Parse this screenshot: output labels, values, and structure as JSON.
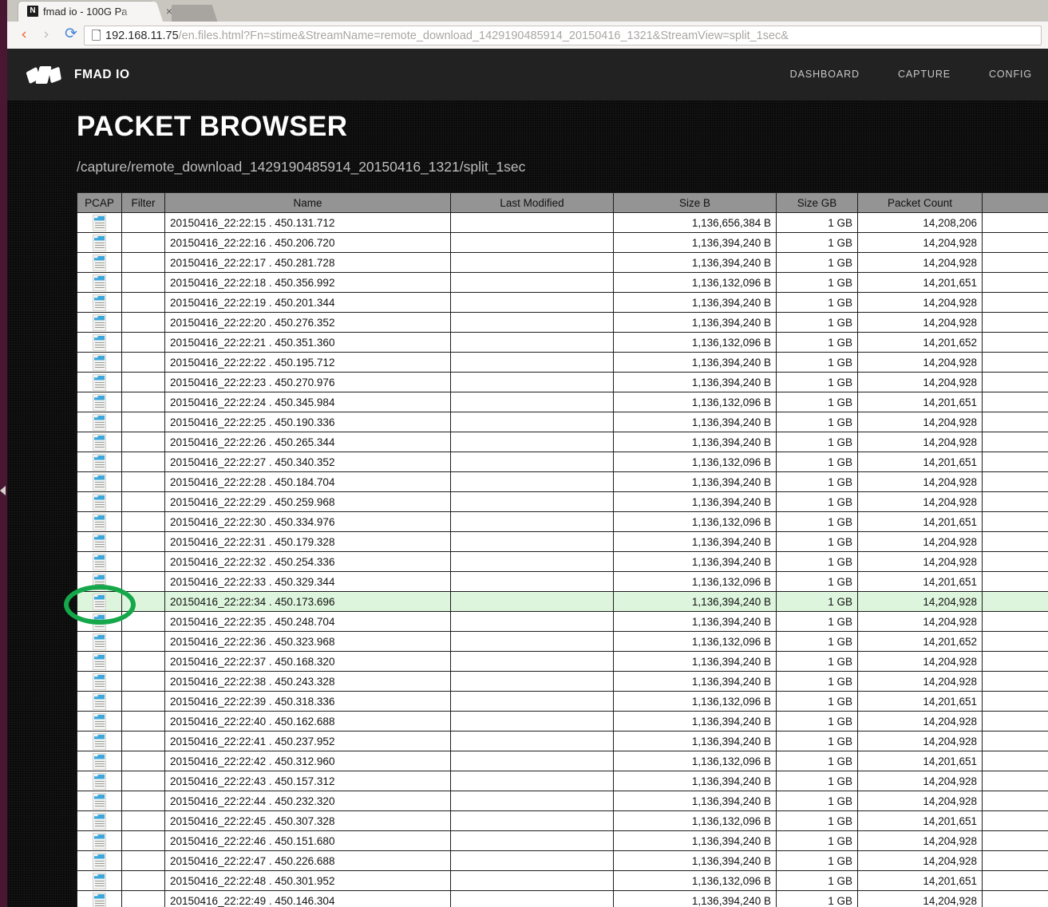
{
  "browser": {
    "tab": {
      "title": "fmad io - 100G Pa",
      "favicon_letter": "N",
      "close_label": "×"
    },
    "back_label": "‹",
    "forward_label": "›",
    "reload_label": "⟳",
    "url_host": "192.168.11.75",
    "url_path": "/en.files.html?Fn=stime&StreamName=remote_download_1429190485914_20150416_1321&StreamView=split_1sec&"
  },
  "site": {
    "brand": "FMAD IO",
    "nav": [
      {
        "label": "DASHBOARD"
      },
      {
        "label": "CAPTURE"
      },
      {
        "label": "CONFIG"
      }
    ]
  },
  "page": {
    "title": "PACKET BROWSER",
    "subtitle": "/capture/remote_download_1429190485914_20150416_1321/split_1sec"
  },
  "table": {
    "columns": [
      "PCAP",
      "Filter",
      "Name",
      "Last Modified",
      "Size B",
      "Size GB",
      "Packet Count",
      ""
    ],
    "selected_row_index": 19,
    "rows": [
      {
        "name": "20150416_22:22:15 . 450.131.712",
        "modified": "",
        "size_b": "1,136,656,384 B",
        "size_gb": "1 GB",
        "packets": "14,208,206"
      },
      {
        "name": "20150416_22:22:16 . 450.206.720",
        "modified": "",
        "size_b": "1,136,394,240 B",
        "size_gb": "1 GB",
        "packets": "14,204,928"
      },
      {
        "name": "20150416_22:22:17 . 450.281.728",
        "modified": "",
        "size_b": "1,136,394,240 B",
        "size_gb": "1 GB",
        "packets": "14,204,928"
      },
      {
        "name": "20150416_22:22:18 . 450.356.992",
        "modified": "",
        "size_b": "1,136,132,096 B",
        "size_gb": "1 GB",
        "packets": "14,201,651"
      },
      {
        "name": "20150416_22:22:19 . 450.201.344",
        "modified": "",
        "size_b": "1,136,394,240 B",
        "size_gb": "1 GB",
        "packets": "14,204,928"
      },
      {
        "name": "20150416_22:22:20 . 450.276.352",
        "modified": "",
        "size_b": "1,136,394,240 B",
        "size_gb": "1 GB",
        "packets": "14,204,928"
      },
      {
        "name": "20150416_22:22:21 . 450.351.360",
        "modified": "",
        "size_b": "1,136,132,096 B",
        "size_gb": "1 GB",
        "packets": "14,201,652"
      },
      {
        "name": "20150416_22:22:22 . 450.195.712",
        "modified": "",
        "size_b": "1,136,394,240 B",
        "size_gb": "1 GB",
        "packets": "14,204,928"
      },
      {
        "name": "20150416_22:22:23 . 450.270.976",
        "modified": "",
        "size_b": "1,136,394,240 B",
        "size_gb": "1 GB",
        "packets": "14,204,928"
      },
      {
        "name": "20150416_22:22:24 . 450.345.984",
        "modified": "",
        "size_b": "1,136,132,096 B",
        "size_gb": "1 GB",
        "packets": "14,201,651"
      },
      {
        "name": "20150416_22:22:25 . 450.190.336",
        "modified": "",
        "size_b": "1,136,394,240 B",
        "size_gb": "1 GB",
        "packets": "14,204,928"
      },
      {
        "name": "20150416_22:22:26 . 450.265.344",
        "modified": "",
        "size_b": "1,136,394,240 B",
        "size_gb": "1 GB",
        "packets": "14,204,928"
      },
      {
        "name": "20150416_22:22:27 . 450.340.352",
        "modified": "",
        "size_b": "1,136,132,096 B",
        "size_gb": "1 GB",
        "packets": "14,201,651"
      },
      {
        "name": "20150416_22:22:28 . 450.184.704",
        "modified": "",
        "size_b": "1,136,394,240 B",
        "size_gb": "1 GB",
        "packets": "14,204,928"
      },
      {
        "name": "20150416_22:22:29 . 450.259.968",
        "modified": "",
        "size_b": "1,136,394,240 B",
        "size_gb": "1 GB",
        "packets": "14,204,928"
      },
      {
        "name": "20150416_22:22:30 . 450.334.976",
        "modified": "",
        "size_b": "1,136,132,096 B",
        "size_gb": "1 GB",
        "packets": "14,201,651"
      },
      {
        "name": "20150416_22:22:31 . 450.179.328",
        "modified": "",
        "size_b": "1,136,394,240 B",
        "size_gb": "1 GB",
        "packets": "14,204,928"
      },
      {
        "name": "20150416_22:22:32 . 450.254.336",
        "modified": "",
        "size_b": "1,136,394,240 B",
        "size_gb": "1 GB",
        "packets": "14,204,928"
      },
      {
        "name": "20150416_22:22:33 . 450.329.344",
        "modified": "",
        "size_b": "1,136,132,096 B",
        "size_gb": "1 GB",
        "packets": "14,201,651"
      },
      {
        "name": "20150416_22:22:34 . 450.173.696",
        "modified": "",
        "size_b": "1,136,394,240 B",
        "size_gb": "1 GB",
        "packets": "14,204,928"
      },
      {
        "name": "20150416_22:22:35 . 450.248.704",
        "modified": "",
        "size_b": "1,136,394,240 B",
        "size_gb": "1 GB",
        "packets": "14,204,928"
      },
      {
        "name": "20150416_22:22:36 . 450.323.968",
        "modified": "",
        "size_b": "1,136,132,096 B",
        "size_gb": "1 GB",
        "packets": "14,201,652"
      },
      {
        "name": "20150416_22:22:37 . 450.168.320",
        "modified": "",
        "size_b": "1,136,394,240 B",
        "size_gb": "1 GB",
        "packets": "14,204,928"
      },
      {
        "name": "20150416_22:22:38 . 450.243.328",
        "modified": "",
        "size_b": "1,136,394,240 B",
        "size_gb": "1 GB",
        "packets": "14,204,928"
      },
      {
        "name": "20150416_22:22:39 . 450.318.336",
        "modified": "",
        "size_b": "1,136,132,096 B",
        "size_gb": "1 GB",
        "packets": "14,201,651"
      },
      {
        "name": "20150416_22:22:40 . 450.162.688",
        "modified": "",
        "size_b": "1,136,394,240 B",
        "size_gb": "1 GB",
        "packets": "14,204,928"
      },
      {
        "name": "20150416_22:22:41 . 450.237.952",
        "modified": "",
        "size_b": "1,136,394,240 B",
        "size_gb": "1 GB",
        "packets": "14,204,928"
      },
      {
        "name": "20150416_22:22:42 . 450.312.960",
        "modified": "",
        "size_b": "1,136,132,096 B",
        "size_gb": "1 GB",
        "packets": "14,201,651"
      },
      {
        "name": "20150416_22:22:43 . 450.157.312",
        "modified": "",
        "size_b": "1,136,394,240 B",
        "size_gb": "1 GB",
        "packets": "14,204,928"
      },
      {
        "name": "20150416_22:22:44 . 450.232.320",
        "modified": "",
        "size_b": "1,136,394,240 B",
        "size_gb": "1 GB",
        "packets": "14,204,928"
      },
      {
        "name": "20150416_22:22:45 . 450.307.328",
        "modified": "",
        "size_b": "1,136,132,096 B",
        "size_gb": "1 GB",
        "packets": "14,201,651"
      },
      {
        "name": "20150416_22:22:46 . 450.151.680",
        "modified": "",
        "size_b": "1,136,394,240 B",
        "size_gb": "1 GB",
        "packets": "14,204,928"
      },
      {
        "name": "20150416_22:22:47 . 450.226.688",
        "modified": "",
        "size_b": "1,136,394,240 B",
        "size_gb": "1 GB",
        "packets": "14,204,928"
      },
      {
        "name": "20150416_22:22:48 . 450.301.952",
        "modified": "",
        "size_b": "1,136,132,096 B",
        "size_gb": "1 GB",
        "packets": "14,201,651"
      },
      {
        "name": "20150416_22:22:49 . 450.146.304",
        "modified": "",
        "size_b": "1,136,394,240 B",
        "size_gb": "1 GB",
        "packets": "14,204,928"
      }
    ]
  },
  "annotation": {
    "shape": "ellipse",
    "color": "#15a84a",
    "target": "pcap-icon of selected row"
  }
}
